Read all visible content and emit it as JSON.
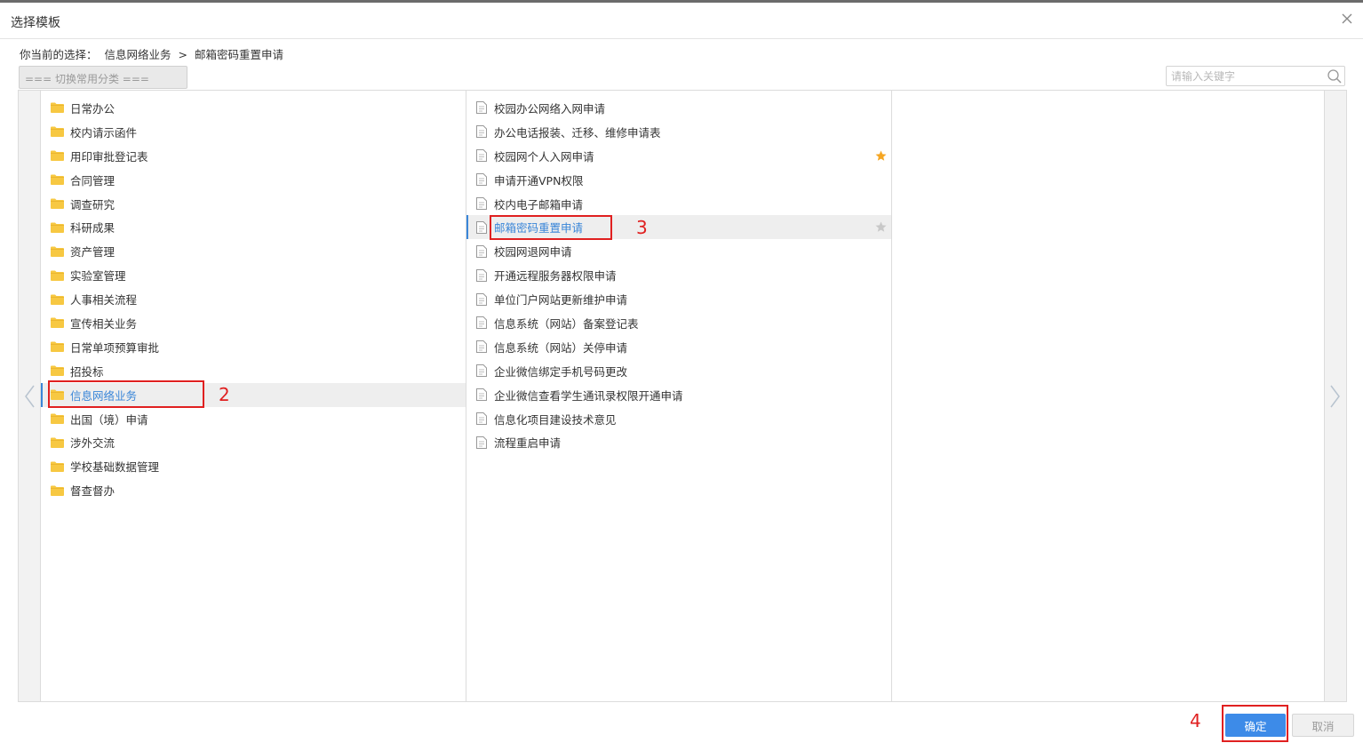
{
  "dialog": {
    "title": "选择模板"
  },
  "selection": {
    "prefix": "你当前的选择：",
    "category": "信息网络业务",
    "separator": ">",
    "item": "邮箱密码重置申请"
  },
  "category_switch": {
    "label": "=== 切换常用分类 ==="
  },
  "search": {
    "placeholder": "请输入关键字"
  },
  "categories": [
    "日常办公",
    "校内请示函件",
    "用印审批登记表",
    "合同管理",
    "调查研究",
    "科研成果",
    "资产管理",
    "实验室管理",
    "人事相关流程",
    "宣传相关业务",
    "日常单项预算审批",
    "招投标",
    "信息网络业务",
    "出国（境）申请",
    "涉外交流",
    "学校基础数据管理",
    "督查督办"
  ],
  "active_category_index": 12,
  "templates": [
    "校园办公网络入网申请",
    "办公电话报装、迁移、维修申请表",
    "校园网个人入网申请",
    "申请开通VPN权限",
    "校内电子邮箱申请",
    "邮箱密码重置申请",
    "校园网退网申请",
    "开通远程服务器权限申请",
    "单位门户网站更新维护申请",
    "信息系统（网站）备案登记表",
    "信息系统（网站）关停申请",
    "企业微信绑定手机号码更改",
    "企业微信查看学生通讯录权限开通申请",
    "信息化项目建设技术意见",
    "流程重启申请"
  ],
  "active_template_index": 5,
  "starred_template_index": 2,
  "annotations": {
    "step2": "2",
    "step3": "3",
    "step4": "4"
  },
  "buttons": {
    "ok": "确定",
    "cancel": "取消"
  },
  "colors": {
    "accent": "#3d8be8",
    "annotation": "#e02020",
    "star_on": "#f5a623",
    "star_off": "#c8c8c8",
    "folder": "#f7c842"
  }
}
